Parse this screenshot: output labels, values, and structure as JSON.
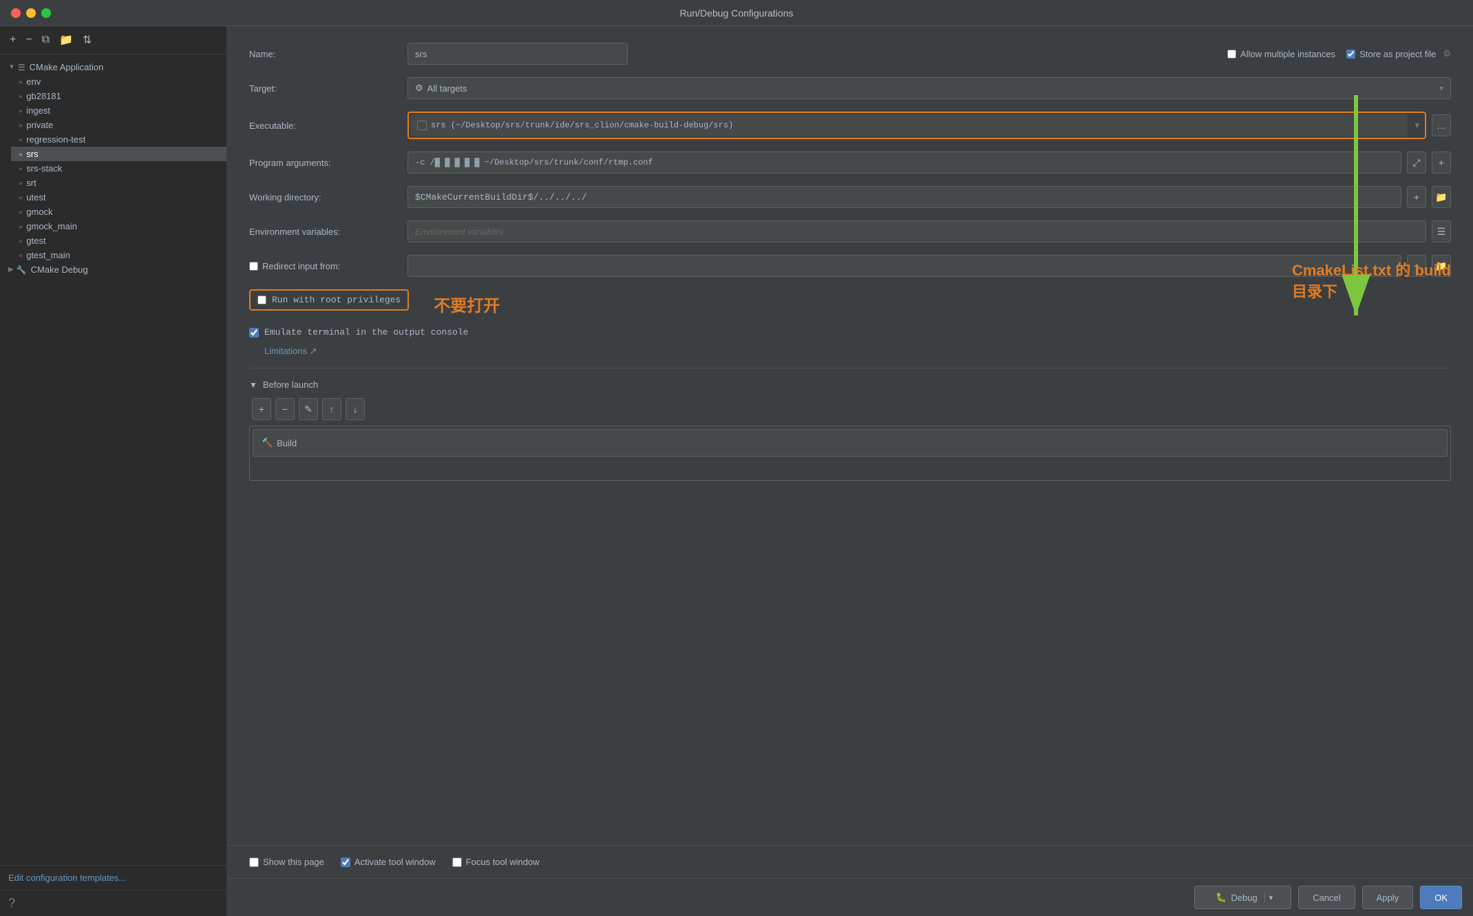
{
  "window": {
    "title": "Run/Debug Configurations"
  },
  "sidebar": {
    "toolbar": {
      "add_btn": "+",
      "remove_btn": "−",
      "copy_btn": "⧉",
      "folder_btn": "📁",
      "sort_btn": "⇅"
    },
    "tree": {
      "cmake_app_label": "CMake Application",
      "items": [
        {
          "label": "env",
          "id": "env"
        },
        {
          "label": "gb28181",
          "id": "gb28181"
        },
        {
          "label": "ingest",
          "id": "ingest"
        },
        {
          "label": "private",
          "id": "private"
        },
        {
          "label": "regression-test",
          "id": "regression-test"
        },
        {
          "label": "srs",
          "id": "srs",
          "selected": true
        },
        {
          "label": "srs-stack",
          "id": "srs-stack"
        },
        {
          "label": "srt",
          "id": "srt"
        },
        {
          "label": "utest",
          "id": "utest"
        },
        {
          "label": "gmock",
          "id": "gmock"
        },
        {
          "label": "gmock_main",
          "id": "gmock_main"
        },
        {
          "label": "gtest",
          "id": "gtest"
        },
        {
          "label": "gtest_main",
          "id": "gtest_main"
        }
      ],
      "cmake_debug_label": "CMake Debug"
    },
    "footer_link": "Edit configuration templates...",
    "help_icon": "?"
  },
  "form": {
    "name_label": "Name:",
    "name_value": "srs",
    "allow_multiple_label": "Allow multiple instances",
    "store_as_project_label": "Store as project file",
    "target_label": "Target:",
    "target_value": "All targets",
    "executable_label": "Executable:",
    "executable_value": "srs  (~/Desktop/srs/trunk/ide/srs_clion/cmake-build-debug/srs)",
    "program_args_label": "Program arguments:",
    "program_args_value": "-c /█ █  █  █  █  █ ~/Desktop/srs/trunk/conf/rtmp.conf",
    "working_dir_label": "Working directory:",
    "working_dir_value": "$CMakeCurrentBuildDir$/../../../",
    "env_vars_label": "Environment variables:",
    "env_vars_placeholder": "Environment variables",
    "redirect_input_label": "Redirect input from:",
    "redirect_input_value": "",
    "run_root_label": "Run with root privileges",
    "run_root_checked": false,
    "annotation_text": "不要打开",
    "emulate_terminal_label": "Emulate terminal in the output console",
    "emulate_terminal_checked": true,
    "limitations_link": "Limitations ↗",
    "before_launch_label": "Before launch",
    "before_launch_toolbar": {
      "add": "+",
      "remove": "−",
      "edit": "✎",
      "up": "↑",
      "down": "↓"
    },
    "build_item_label": "Build",
    "bottom": {
      "show_page_label": "Show this page",
      "show_page_checked": false,
      "activate_tool_label": "Activate tool window",
      "activate_tool_checked": true,
      "focus_tool_label": "Focus tool window",
      "focus_tool_checked": false
    }
  },
  "actions": {
    "debug_label": "Debug",
    "cancel_label": "Cancel",
    "apply_label": "Apply",
    "ok_label": "OK"
  },
  "annotation": {
    "cmake_note_line1": "CmakeList.txt 的 build",
    "cmake_note_line2": "目录下"
  }
}
